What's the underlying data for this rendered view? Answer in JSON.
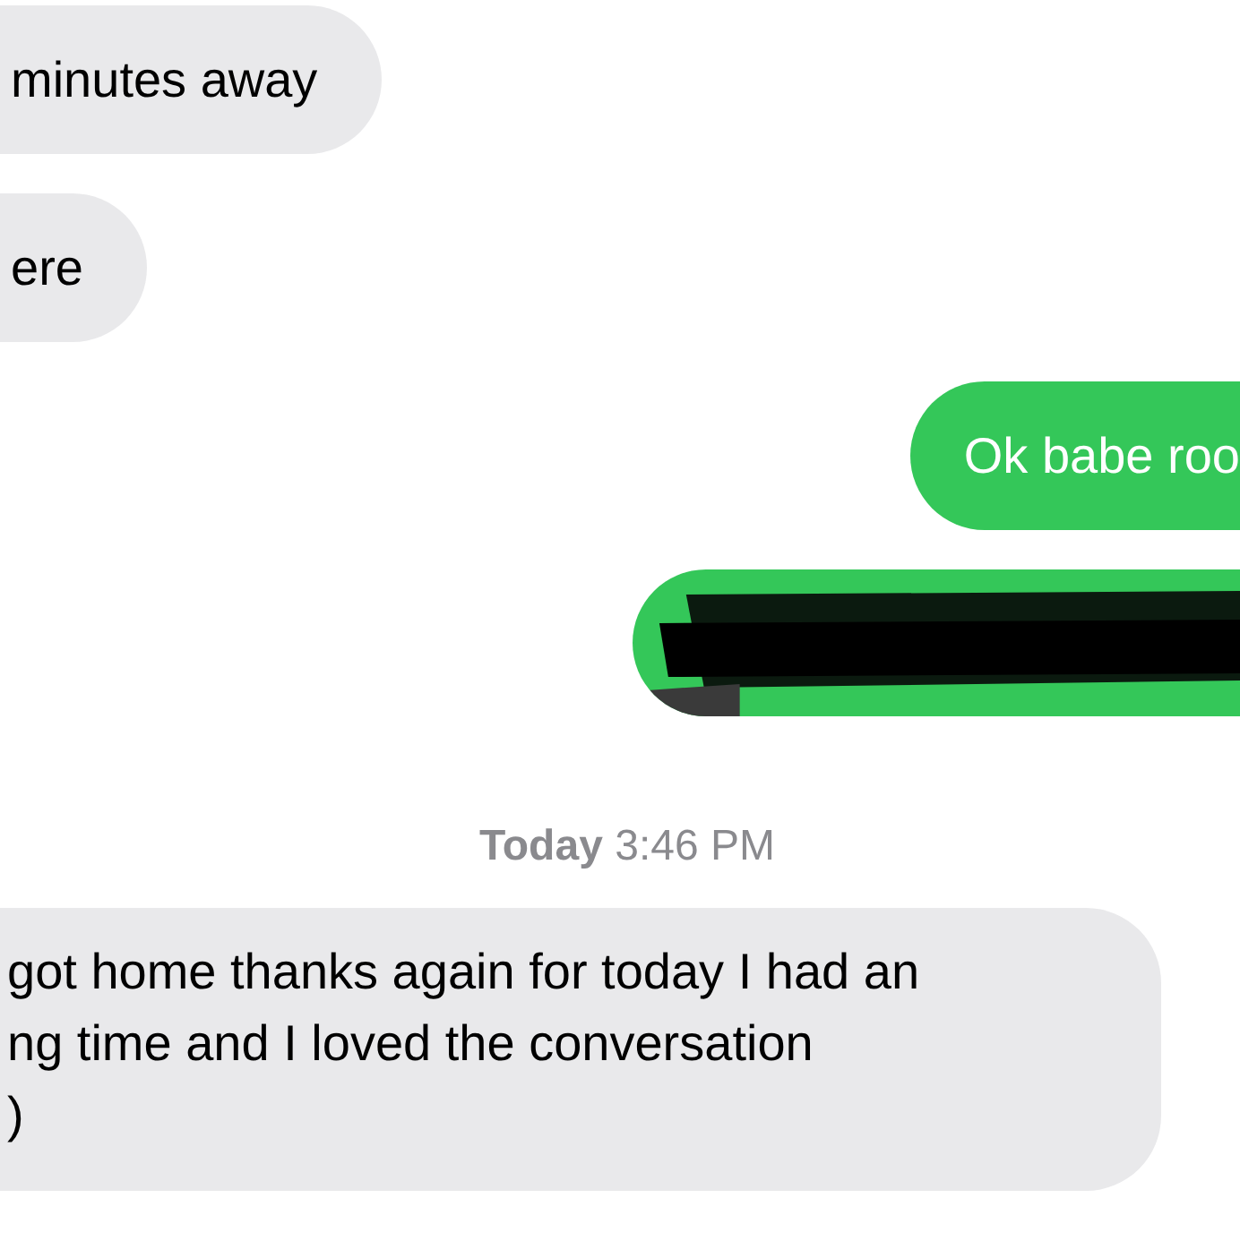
{
  "messages": [
    {
      "kind": "incoming",
      "text": "minutes away"
    },
    {
      "kind": "incoming",
      "text": "ere"
    },
    {
      "kind": "outgoing",
      "text": "Ok babe roo"
    },
    {
      "kind": "redacted"
    },
    {
      "kind": "timestamp",
      "text": "**Today** 3:46 PM"
    },
    {
      "kind": "incoming",
      "text": "got home thanks again for today I had an\nng time and I loved the conversation\n)"
    }
  ]
}
